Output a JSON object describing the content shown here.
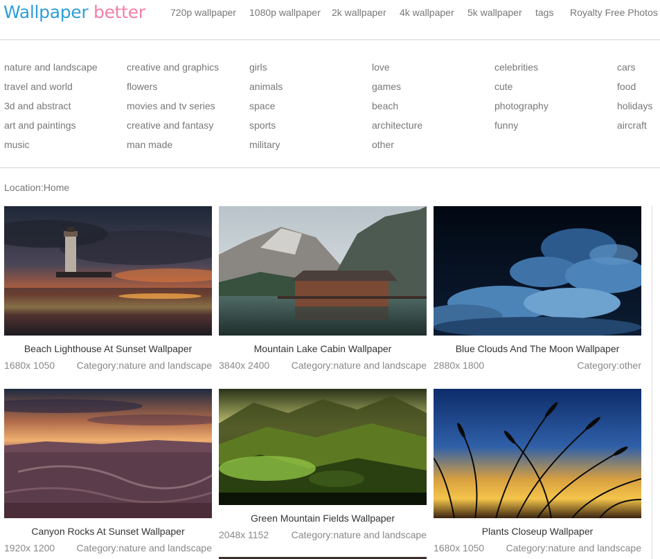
{
  "brand": {
    "word1": "Wallpaper",
    "word2": "better",
    "color1": "#2e9ed9",
    "color2": "#f27fa5"
  },
  "nav": [
    "720p wallpaper",
    "1080p wallpaper",
    "2k wallpaper",
    "4k wallpaper",
    "5k wallpaper",
    "tags",
    "Royalty Free Photos"
  ],
  "categories": [
    [
      "nature and landscape",
      "travel and world",
      "3d and abstract",
      "art and paintings",
      "music"
    ],
    [
      "creative and graphics",
      "flowers",
      "movies and tv series",
      "creative and fantasy",
      "man made"
    ],
    [
      "girls",
      "animals",
      "space",
      "sports",
      "military"
    ],
    [
      "love",
      "games",
      "beach",
      "architecture",
      "other"
    ],
    [
      "celebrities",
      "cute",
      "photography",
      "funny"
    ],
    [
      "cars",
      "food",
      "holidays",
      "aircraft"
    ]
  ],
  "location": "Location:Home",
  "category_prefix": "Category:",
  "wallpapers": [
    {
      "title": "Beach Lighthouse At Sunset Wallpaper",
      "resolution": "1680x 1050",
      "category": "nature and landscape",
      "image": "lighthouse-sunset"
    },
    {
      "title": "Mountain Lake Cabin Wallpaper",
      "resolution": "3840x 2400",
      "category": "nature and landscape",
      "image": "mountain-lake-cabin"
    },
    {
      "title": "Blue Clouds And The Moon Wallpaper",
      "resolution": "2880x 1800",
      "category": "other",
      "image": "blue-clouds-moon"
    },
    {
      "title": "Canyon Rocks At Sunset Wallpaper",
      "resolution": "1920x 1200",
      "category": "nature and landscape",
      "image": "canyon-sunset"
    },
    {
      "title": "Green Mountain Fields Wallpaper",
      "resolution": "2048x 1152",
      "category": "nature and landscape",
      "image": "green-mountain-fields"
    },
    {
      "title": "Plants Closeup Wallpaper",
      "resolution": "1680x 1050",
      "category": "nature and landscape",
      "image": "plants-closeup"
    }
  ]
}
